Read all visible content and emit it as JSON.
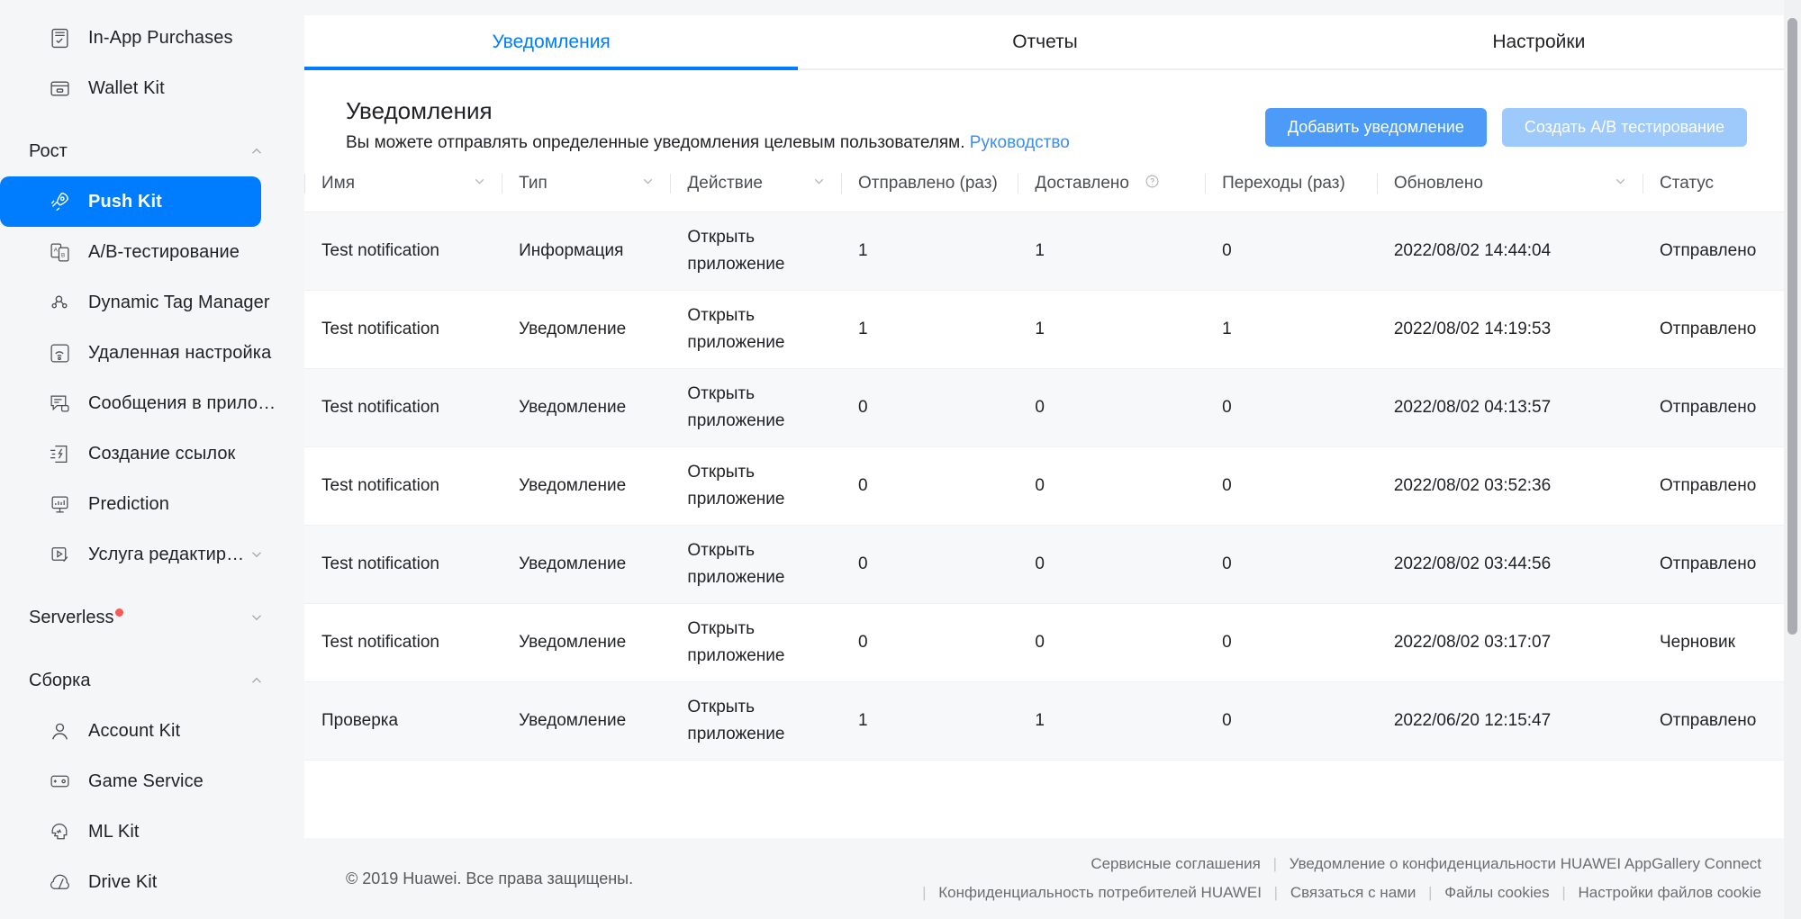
{
  "sidebar": {
    "items_top": [
      {
        "label": "In-App Purchases",
        "icon": "in-app-purchases-icon"
      },
      {
        "label": "Wallet Kit",
        "icon": "wallet-icon"
      }
    ],
    "group_growth": {
      "label": "Рост",
      "chevron": "chevron-up-icon"
    },
    "growth_items": [
      {
        "label": "Push Kit",
        "icon": "rocket-icon",
        "active": true
      },
      {
        "label": "A/B-тестирование",
        "icon": "ab-test-icon"
      },
      {
        "label": "Dynamic Tag Manager",
        "icon": "tag-manager-icon"
      },
      {
        "label": "Удаленная настройка",
        "icon": "remote-config-icon"
      },
      {
        "label": "Сообщения в прило…",
        "icon": "in-app-messaging-icon"
      },
      {
        "label": "Создание ссылок",
        "icon": "app-linking-icon"
      },
      {
        "label": "Prediction",
        "icon": "prediction-icon"
      },
      {
        "label": "Услуга редактир…",
        "icon": "video-editor-icon",
        "chevron": "chevron-down-icon"
      }
    ],
    "group_serverless": {
      "label": "Serverless",
      "chevron": "chevron-down-icon",
      "badge": true
    },
    "group_build": {
      "label": "Сборка",
      "chevron": "chevron-up-icon"
    },
    "build_items": [
      {
        "label": "Account Kit",
        "icon": "account-icon"
      },
      {
        "label": "Game Service",
        "icon": "gamepad-icon"
      },
      {
        "label": "ML Kit",
        "icon": "ml-head-icon"
      },
      {
        "label": "Drive Kit",
        "icon": "drive-cloud-icon"
      }
    ]
  },
  "tabs": [
    {
      "label": "Уведомления",
      "active": true
    },
    {
      "label": "Отчеты",
      "active": false
    },
    {
      "label": "Настройки",
      "active": false
    }
  ],
  "header": {
    "title": "Уведомления",
    "subtitle": "Вы можете отправлять определенные уведомления целевым пользователям.",
    "link": "Руководство",
    "primary_button": "Добавить уведомление",
    "secondary_button": "Создать A/B тестирование"
  },
  "table": {
    "columns": [
      {
        "label": "Имя",
        "sortable": true
      },
      {
        "label": "Тип",
        "sortable": true
      },
      {
        "label": "Действие",
        "sortable": true
      },
      {
        "label": "Отправлено (раз)",
        "sortable": false
      },
      {
        "label": "Доставлено",
        "sortable": false,
        "help": true
      },
      {
        "label": "Переходы (раз)",
        "sortable": false
      },
      {
        "label": "Обновлено",
        "sortable": true
      },
      {
        "label": "Статус",
        "sortable": false
      }
    ],
    "rows": [
      {
        "name": "Test notification",
        "type": "Информация",
        "action": "Открыть приложение",
        "sent": "1",
        "delivered": "1",
        "clicks": "0",
        "updated": "2022/08/02 14:44:04",
        "status": "Отправлено"
      },
      {
        "name": "Test notification",
        "type": "Уведомление",
        "action": "Открыть приложение",
        "sent": "1",
        "delivered": "1",
        "clicks": "1",
        "updated": "2022/08/02 14:19:53",
        "status": "Отправлено"
      },
      {
        "name": "Test notification",
        "type": "Уведомление",
        "action": "Открыть приложение",
        "sent": "0",
        "delivered": "0",
        "clicks": "0",
        "updated": "2022/08/02 04:13:57",
        "status": "Отправлено"
      },
      {
        "name": "Test notification",
        "type": "Уведомление",
        "action": "Открыть приложение",
        "sent": "0",
        "delivered": "0",
        "clicks": "0",
        "updated": "2022/08/02 03:52:36",
        "status": "Отправлено"
      },
      {
        "name": "Test notification",
        "type": "Уведомление",
        "action": "Открыть приложение",
        "sent": "0",
        "delivered": "0",
        "clicks": "0",
        "updated": "2022/08/02 03:44:56",
        "status": "Отправлено"
      },
      {
        "name": "Test notification",
        "type": "Уведомление",
        "action": "Открыть приложение",
        "sent": "0",
        "delivered": "0",
        "clicks": "0",
        "updated": "2022/08/02 03:17:07",
        "status": "Черновик"
      },
      {
        "name": "Проверка",
        "type": "Уведомление",
        "action": "Открыть приложение",
        "sent": "1",
        "delivered": "1",
        "clicks": "0",
        "updated": "2022/06/20 12:15:47",
        "status": "Отправлено"
      }
    ]
  },
  "footer": {
    "copyright": "© 2019 Huawei. Все права защищены.",
    "links_row1": [
      "Сервисные соглашения",
      "Уведомление о конфиденциальности HUAWEI AppGallery Connect"
    ],
    "links_row2": [
      "Конфиденциальность потребителей HUAWEI",
      "Связаться с нами",
      "Файлы cookies",
      "Настройки файлов cookie"
    ]
  },
  "colors": {
    "accent": "#007dff",
    "link": "#3c8df5",
    "primary_button": "#4d9bf8",
    "secondary_button": "#9ec9fb",
    "badge_red": "#fa5a53",
    "page_bg": "#f5f6f7"
  }
}
